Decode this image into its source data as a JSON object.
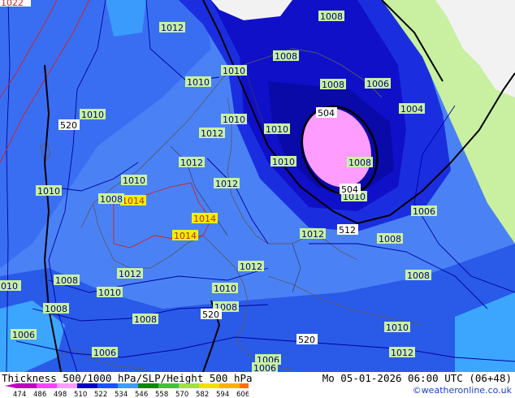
{
  "header": {
    "title": "Thickness 500/1000 hPa/SLP/Height 500 hPa",
    "datetime": "Mo 05-01-2026 06:00 UTC (06+48)",
    "credit": "©weatheronline.co.uk"
  },
  "legend": {
    "ticks": [
      "474",
      "486",
      "498",
      "510",
      "522",
      "534",
      "546",
      "558",
      "570",
      "582",
      "594",
      "606"
    ],
    "colors": [
      "#c000c0",
      "#ff40ff",
      "#ff9cff",
      "#0000c8",
      "#1e50ff",
      "#3c9cff",
      "#0a8a0a",
      "#40c040",
      "#a0e040",
      "#f0e000",
      "#ffb000",
      "#ff7000"
    ]
  },
  "map": {
    "colors": {
      "blue_light": "#4a82f5",
      "blue_medium": "#2a55ea",
      "blue_dark": "#1010c8",
      "navy": "#0a0a9a",
      "cyan": "#3ca6ff",
      "pink": "#ff9cff",
      "land_green": "#c8f0a0",
      "land_white": "#f2f2f2"
    },
    "slp_labels": [
      {
        "text": "1022",
        "color": "red"
      },
      {
        "text": "1012",
        "color": "blue"
      },
      {
        "text": "1010",
        "color": "blue"
      },
      {
        "text": "1010",
        "color": "blue"
      },
      {
        "text": "1010",
        "color": "blue"
      },
      {
        "text": "1008",
        "color": "blue"
      },
      {
        "text": "1008",
        "color": "blue"
      },
      {
        "text": "1006",
        "color": "blue"
      },
      {
        "text": "1004",
        "color": "blue"
      },
      {
        "text": "1010",
        "color": "blue"
      },
      {
        "text": "1012",
        "color": "blue"
      },
      {
        "text": "1010",
        "color": "blue"
      },
      {
        "text": "1012",
        "color": "blue"
      },
      {
        "text": "1010",
        "color": "blue"
      },
      {
        "text": "1008",
        "color": "blue"
      },
      {
        "text": "1010",
        "color": "blue"
      },
      {
        "text": "1012",
        "color": "blue"
      },
      {
        "text": "1014",
        "color": "red"
      },
      {
        "text": "1014",
        "color": "red"
      },
      {
        "text": "1014",
        "color": "red"
      },
      {
        "text": "1010",
        "color": "blue"
      },
      {
        "text": "1012",
        "color": "blue"
      },
      {
        "text": "1006",
        "color": "blue"
      },
      {
        "text": "1008",
        "color": "blue"
      },
      {
        "text": "1012",
        "color": "blue"
      },
      {
        "text": "1008",
        "color": "blue"
      },
      {
        "text": "010",
        "color": "blue"
      },
      {
        "text": "1008",
        "color": "blue"
      },
      {
        "text": "1010",
        "color": "blue"
      },
      {
        "text": "1012",
        "color": "blue"
      },
      {
        "text": "1010",
        "color": "blue"
      },
      {
        "text": "1008",
        "color": "blue"
      },
      {
        "text": "1008",
        "color": "blue"
      },
      {
        "text": "1008",
        "color": "blue"
      },
      {
        "text": "1006",
        "color": "blue"
      },
      {
        "text": "1006",
        "color": "blue"
      },
      {
        "text": "1006",
        "color": "blue"
      },
      {
        "text": "1008",
        "color": "blue"
      },
      {
        "text": "1006",
        "color": "blue"
      },
      {
        "text": "1010",
        "color": "blue"
      },
      {
        "text": "1012",
        "color": "blue"
      },
      {
        "text": "1008",
        "color": "blue"
      },
      {
        "text": "1010",
        "color": "blue"
      }
    ],
    "height_labels": [
      "520",
      "504",
      "504",
      "512",
      "520",
      "520"
    ]
  }
}
